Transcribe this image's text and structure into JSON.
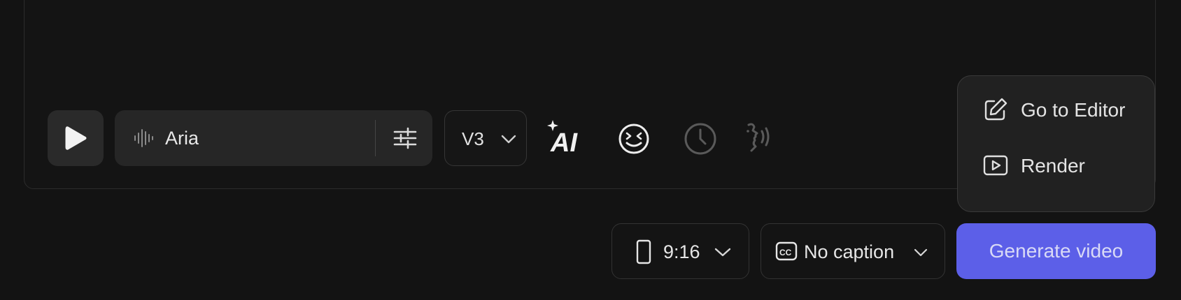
{
  "colors": {
    "background": "#131313",
    "accent": "#5c5fe8",
    "control_bg": "#262626"
  },
  "toolbar": {
    "play_icon": "play-icon",
    "voice": {
      "name": "Aria",
      "icon": "waveform-icon",
      "settings_icon": "sliders-icon"
    },
    "version": {
      "value": "V3"
    },
    "tools": [
      "ai-sparkle-icon",
      "emoji-icon",
      "clock-icon",
      "speaking-head-icon"
    ]
  },
  "menu": {
    "items": [
      {
        "label": "Go to Editor",
        "icon": "edit-icon"
      },
      {
        "label": "Render",
        "icon": "play-square-icon"
      }
    ]
  },
  "footer": {
    "aspect_ratio": "9:16",
    "caption": "No caption",
    "generate_label": "Generate video"
  }
}
